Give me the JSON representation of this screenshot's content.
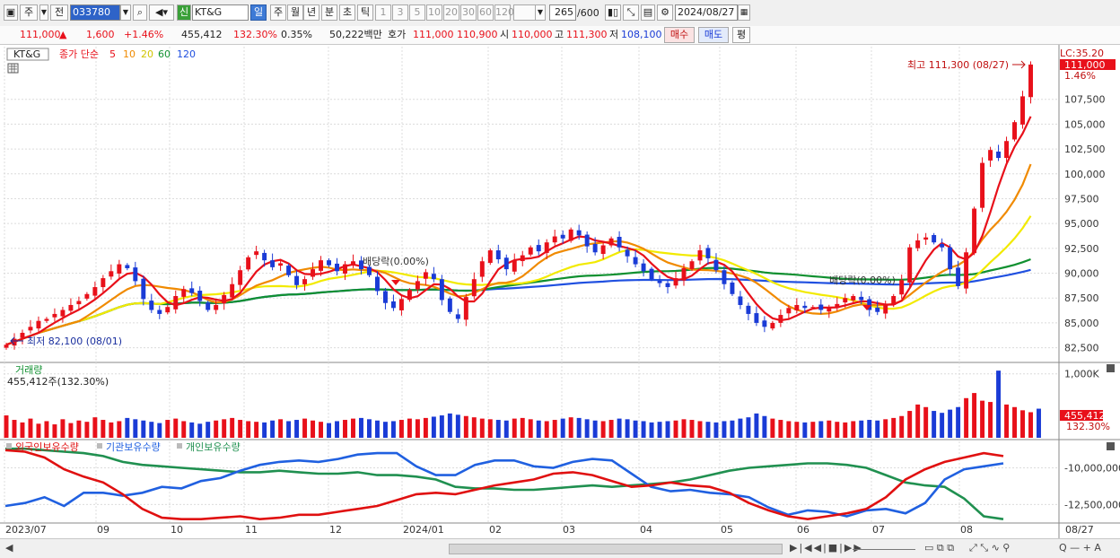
{
  "toolbar": {
    "period_label": "주",
    "prev_label": "전",
    "stock_code": "033780",
    "market_badge": "신",
    "stock_name": "KT&G",
    "period_tabs": [
      "일",
      "주",
      "월",
      "년",
      "분",
      "초",
      "틱"
    ],
    "interval_buttons": [
      "1",
      "3",
      "5",
      "10",
      "20",
      "30",
      "60",
      "120"
    ],
    "count_value": "265",
    "count_max": "/600",
    "date_value": "2024/08/27"
  },
  "quote": {
    "price": "111,000",
    "change": "1,600",
    "change_pct": "+1.46%",
    "volume": "455,412",
    "volume_ratio": "132.30%",
    "turnover_pct": "0.35%",
    "trade_value": "50,222백만",
    "ask_label": "호가",
    "ask": "111,000",
    "bid": "110,900",
    "open_label": "시",
    "open": "110,000",
    "high_label": "고",
    "high": "111,300",
    "low_label": "저",
    "low": "108,100",
    "buy_button": "매수",
    "sell_button": "매도",
    "eval_button": "평"
  },
  "legend": {
    "ticker": "KT&G",
    "ma_title": "종가 단순",
    "ma_periods": [
      "5",
      "10",
      "20",
      "60",
      "120"
    ]
  },
  "annotations": {
    "high": "최고 111,300 (08/27)",
    "low": "최저 82,100 (08/01)",
    "dividend_1": "배당락(0.00%)",
    "dividend_2": "배당락(0.00%)",
    "lc": "LC:35.20",
    "last_price": "111,000",
    "last_pct": "1.46%",
    "vol_label": "455,412",
    "vol_pct": "132.30%"
  },
  "volume_panel": {
    "title": "거래량",
    "subtitle": "455,412주(132.30%)"
  },
  "holdings_panel": {
    "series": [
      "외국인보유수량",
      "기관보유수량",
      "개인보유수량"
    ]
  },
  "scrollbar": {
    "controls": "▶|◀◀|■|▶▶"
  },
  "colors": {
    "up": "#e8101a",
    "down": "#1a3bd6",
    "ma5": "#e8101a",
    "ma10": "#f08a00",
    "ma20": "#f2ea00",
    "ma60": "#109030",
    "ma120": "#2050e0",
    "foreign": "#e01010",
    "institution": "#2060e0",
    "individual": "#209050"
  },
  "chart_data": {
    "type": "candlestick",
    "x_ticks": [
      "2023/07",
      "09",
      "10",
      "11",
      "12",
      "2024/01",
      "02",
      "03",
      "04",
      "05",
      "06",
      "07",
      "08",
      "08/27"
    ],
    "y_ticks": [
      "82,500",
      "85,000",
      "87,500",
      "90,000",
      "92,500",
      "95,000",
      "97,500",
      "100,000",
      "102,500",
      "105,000",
      "107,500"
    ],
    "ylim": [
      81200,
      112800
    ],
    "volume_ticks": [
      "1,000K"
    ],
    "volume_ylim": [
      0,
      1150
    ],
    "holdings_ticks": [
      "-10,000,000",
      "-12,500,000"
    ],
    "holdings_ylim": [
      -13700,
      -8200
    ],
    "close": [
      82800,
      83400,
      84000,
      84600,
      85200,
      85400,
      85900,
      86300,
      86800,
      87200,
      87900,
      88600,
      89500,
      90200,
      90900,
      90500,
      89200,
      87400,
      86300,
      85900,
      86600,
      87700,
      88400,
      88000,
      87200,
      86300,
      86800,
      87800,
      88900,
      90300,
      91600,
      92200,
      91300,
      90600,
      91000,
      89800,
      88800,
      89400,
      90400,
      91300,
      90800,
      90200,
      90900,
      91200,
      90400,
      89800,
      88200,
      87000,
      86500,
      87400,
      88300,
      89200,
      90100,
      89400,
      87300,
      86100,
      85400,
      87600,
      89400,
      91200,
      92300,
      91400,
      90400,
      91300,
      91800,
      92600,
      92200,
      93100,
      93700,
      93500,
      94400,
      93800,
      92700,
      92100,
      92800,
      93500,
      92600,
      91700,
      90900,
      90200,
      89400,
      89000,
      88600,
      89500,
      90500,
      91200,
      92300,
      91500,
      90300,
      88900,
      87900,
      86800,
      85900,
      85000,
      84600,
      85000,
      85800,
      86500,
      86800,
      86500,
      86600,
      86300,
      86500,
      86900,
      87500,
      87700,
      87300,
      86300,
      86100,
      86800,
      87700,
      89300,
      92600,
      93300,
      93600,
      93100,
      92600,
      90400,
      88700,
      92100,
      96500,
      101100,
      102400,
      101600,
      103300,
      105200,
      107800,
      111000
    ],
    "volume": [
      350,
      280,
      240,
      300,
      220,
      260,
      210,
      290,
      230,
      270,
      250,
      320,
      280,
      240,
      260,
      310,
      290,
      270,
      250,
      230,
      280,
      300,
      260,
      240,
      220,
      250,
      270,
      290,
      310,
      280,
      260,
      250,
      240,
      270,
      290,
      260,
      280,
      300,
      270,
      250,
      230,
      260,
      280,
      300,
      310,
      290,
      270,
      250,
      260,
      280,
      300,
      290,
      310,
      330,
      350,
      380,
      360,
      340,
      320,
      300,
      290,
      280,
      270,
      300,
      310,
      290,
      270,
      260,
      280,
      300,
      320,
      310,
      290,
      270,
      260,
      280,
      300,
      290,
      270,
      260,
      240,
      250,
      260,
      270,
      290,
      280,
      260,
      250,
      240,
      260,
      270,
      300,
      320,
      380,
      340,
      300,
      280,
      260,
      250,
      240,
      250,
      260,
      270,
      250,
      240,
      260,
      270,
      280,
      270,
      290,
      310,
      340,
      420,
      520,
      480,
      420,
      390,
      440,
      480,
      620,
      700,
      580,
      560,
      1050,
      520,
      480,
      430,
      400,
      455
    ],
    "foreign_holdings": [
      -8800,
      -8900,
      -9300,
      -10100,
      -10600,
      -11000,
      -11800,
      -12800,
      -13400,
      -13500,
      -13500,
      -13400,
      -13300,
      -13500,
      -13400,
      -13200,
      -13200,
      -13000,
      -12800,
      -12600,
      -12200,
      -11800,
      -11700,
      -11800,
      -11500,
      -11200,
      -11000,
      -10800,
      -10400,
      -10300,
      -10500,
      -10900,
      -11300,
      -11200,
      -11000,
      -11200,
      -11300,
      -11700,
      -12400,
      -12900,
      -13300,
      -13500,
      -13300,
      -13100,
      -12800,
      -12000,
      -10800,
      -10100,
      -9600,
      -9300,
      -9000,
      -9200
    ],
    "institution_holdings": [
      -12600,
      -12400,
      -12000,
      -12600,
      -11700,
      -11700,
      -11900,
      -11700,
      -11300,
      -11400,
      -10900,
      -10700,
      -10200,
      -9800,
      -9600,
      -9500,
      -9600,
      -9400,
      -9100,
      -9000,
      -9000,
      -9900,
      -10500,
      -10500,
      -9800,
      -9500,
      -9500,
      -9900,
      -10000,
      -9600,
      -9400,
      -9500,
      -10400,
      -11300,
      -11600,
      -11500,
      -11700,
      -11800,
      -12000,
      -12700,
      -13200,
      -12900,
      -13000,
      -13300,
      -12900,
      -12800,
      -13100,
      -12400,
      -10800,
      -10100,
      -9900,
      -9700
    ],
    "individual_holdings": [
      -8700,
      -8700,
      -8800,
      -8900,
      -9000,
      -9200,
      -9600,
      -9800,
      -9900,
      -10000,
      -10100,
      -10200,
      -10300,
      -10300,
      -10200,
      -10300,
      -10400,
      -10400,
      -10300,
      -10500,
      -10500,
      -10600,
      -10800,
      -11300,
      -11400,
      -11400,
      -11500,
      -11500,
      -11400,
      -11300,
      -11200,
      -11300,
      -11200,
      -11100,
      -11000,
      -10800,
      -10500,
      -10200,
      -10000,
      -9900,
      -9800,
      -9700,
      -9700,
      -9800,
      -10000,
      -10500,
      -11000,
      -11200,
      -11300,
      -12100,
      -13300,
      -13500
    ]
  }
}
